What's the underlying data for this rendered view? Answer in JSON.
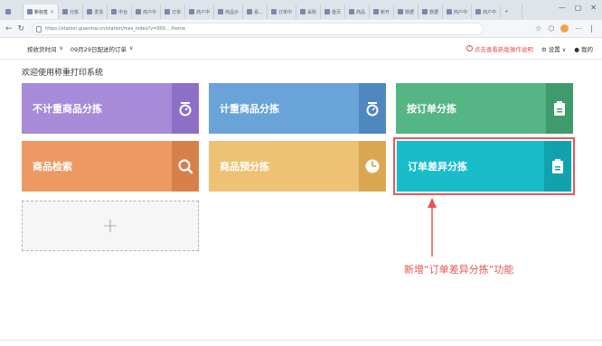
{
  "browser": {
    "tabs": [
      {
        "label": "新标签"
      },
      {
        "label": "分拣"
      },
      {
        "label": "发货"
      },
      {
        "label": "中台"
      },
      {
        "label": "商户中"
      },
      {
        "label": "订单"
      },
      {
        "label": "商户中"
      },
      {
        "label": "商品价"
      },
      {
        "label": "看..."
      },
      {
        "label": "订单中"
      },
      {
        "label": "采购"
      },
      {
        "label": "首页"
      },
      {
        "label": "商品"
      },
      {
        "label": "新开"
      },
      {
        "label": "数据"
      },
      {
        "label": "数据"
      },
      {
        "label": "商户中"
      },
      {
        "label": "商户中"
      }
    ],
    "url": "https://station.guanmai.cn/station/mes_index?v=000... /home"
  },
  "header": {
    "time_select": "按收货时间",
    "order_select": "09月29日配送的订单",
    "help_link": "点击查看新版操作说明",
    "settings_label": "设置",
    "user_label": "我的"
  },
  "main": {
    "welcome": "欢迎使用称重打印系统",
    "tiles": [
      {
        "label": "不计重商品分拣",
        "icon": "scale-icon"
      },
      {
        "label": "计重商品分拣",
        "icon": "scale-icon"
      },
      {
        "label": "按订单分拣",
        "icon": "clipboard-icon"
      },
      {
        "label": "商品检索",
        "icon": "search-icon"
      },
      {
        "label": "商品预分拣",
        "icon": "clock-pie-icon"
      },
      {
        "label": "订单差异分拣",
        "icon": "clipboard-icon"
      }
    ],
    "add_tile": "+"
  },
  "annotation": {
    "text": "新增“订单差异分拣”功能",
    "color": "#e45555"
  }
}
